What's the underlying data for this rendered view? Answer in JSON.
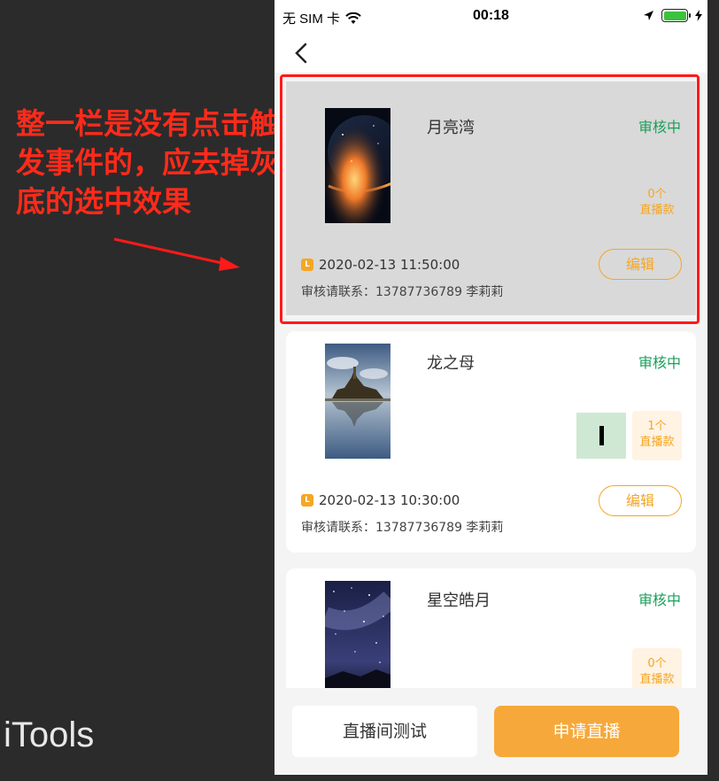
{
  "annotation": {
    "note": "整一栏是没有点击触发事件的，应去掉灰底的选中效果"
  },
  "watermark": "iTools",
  "status_bar": {
    "carrier": "无 SIM 卡",
    "time": "00:18",
    "battery_color": "#3cc23c"
  },
  "items": [
    {
      "title": "月亮湾",
      "status": "审核中",
      "count": "0个",
      "count_label": "直播款",
      "time": "2020-02-13 11:50:00",
      "contact": "审核请联系：13787736789 李莉莉",
      "edit_label": "编辑",
      "thumbnail": "moon-planet-image"
    },
    {
      "title": "龙之母",
      "status": "审核中",
      "count": "1个",
      "count_label": "直播款",
      "time": "2020-02-13 10:30:00",
      "contact": "审核请联系：13787736789 李莉莉",
      "edit_label": "编辑",
      "thumbnail": "castle-lake-image"
    },
    {
      "title": "星空皓月",
      "status": "审核中",
      "count": "0个",
      "count_label": "直播款",
      "thumbnail": "starry-sky-image"
    }
  ],
  "bottom": {
    "test_label": "直播间测试",
    "apply_label": "申请直播"
  },
  "colors": {
    "accent": "#f5a623",
    "status_green": "#1aa05a",
    "annotation_red": "#ff1a1a"
  }
}
